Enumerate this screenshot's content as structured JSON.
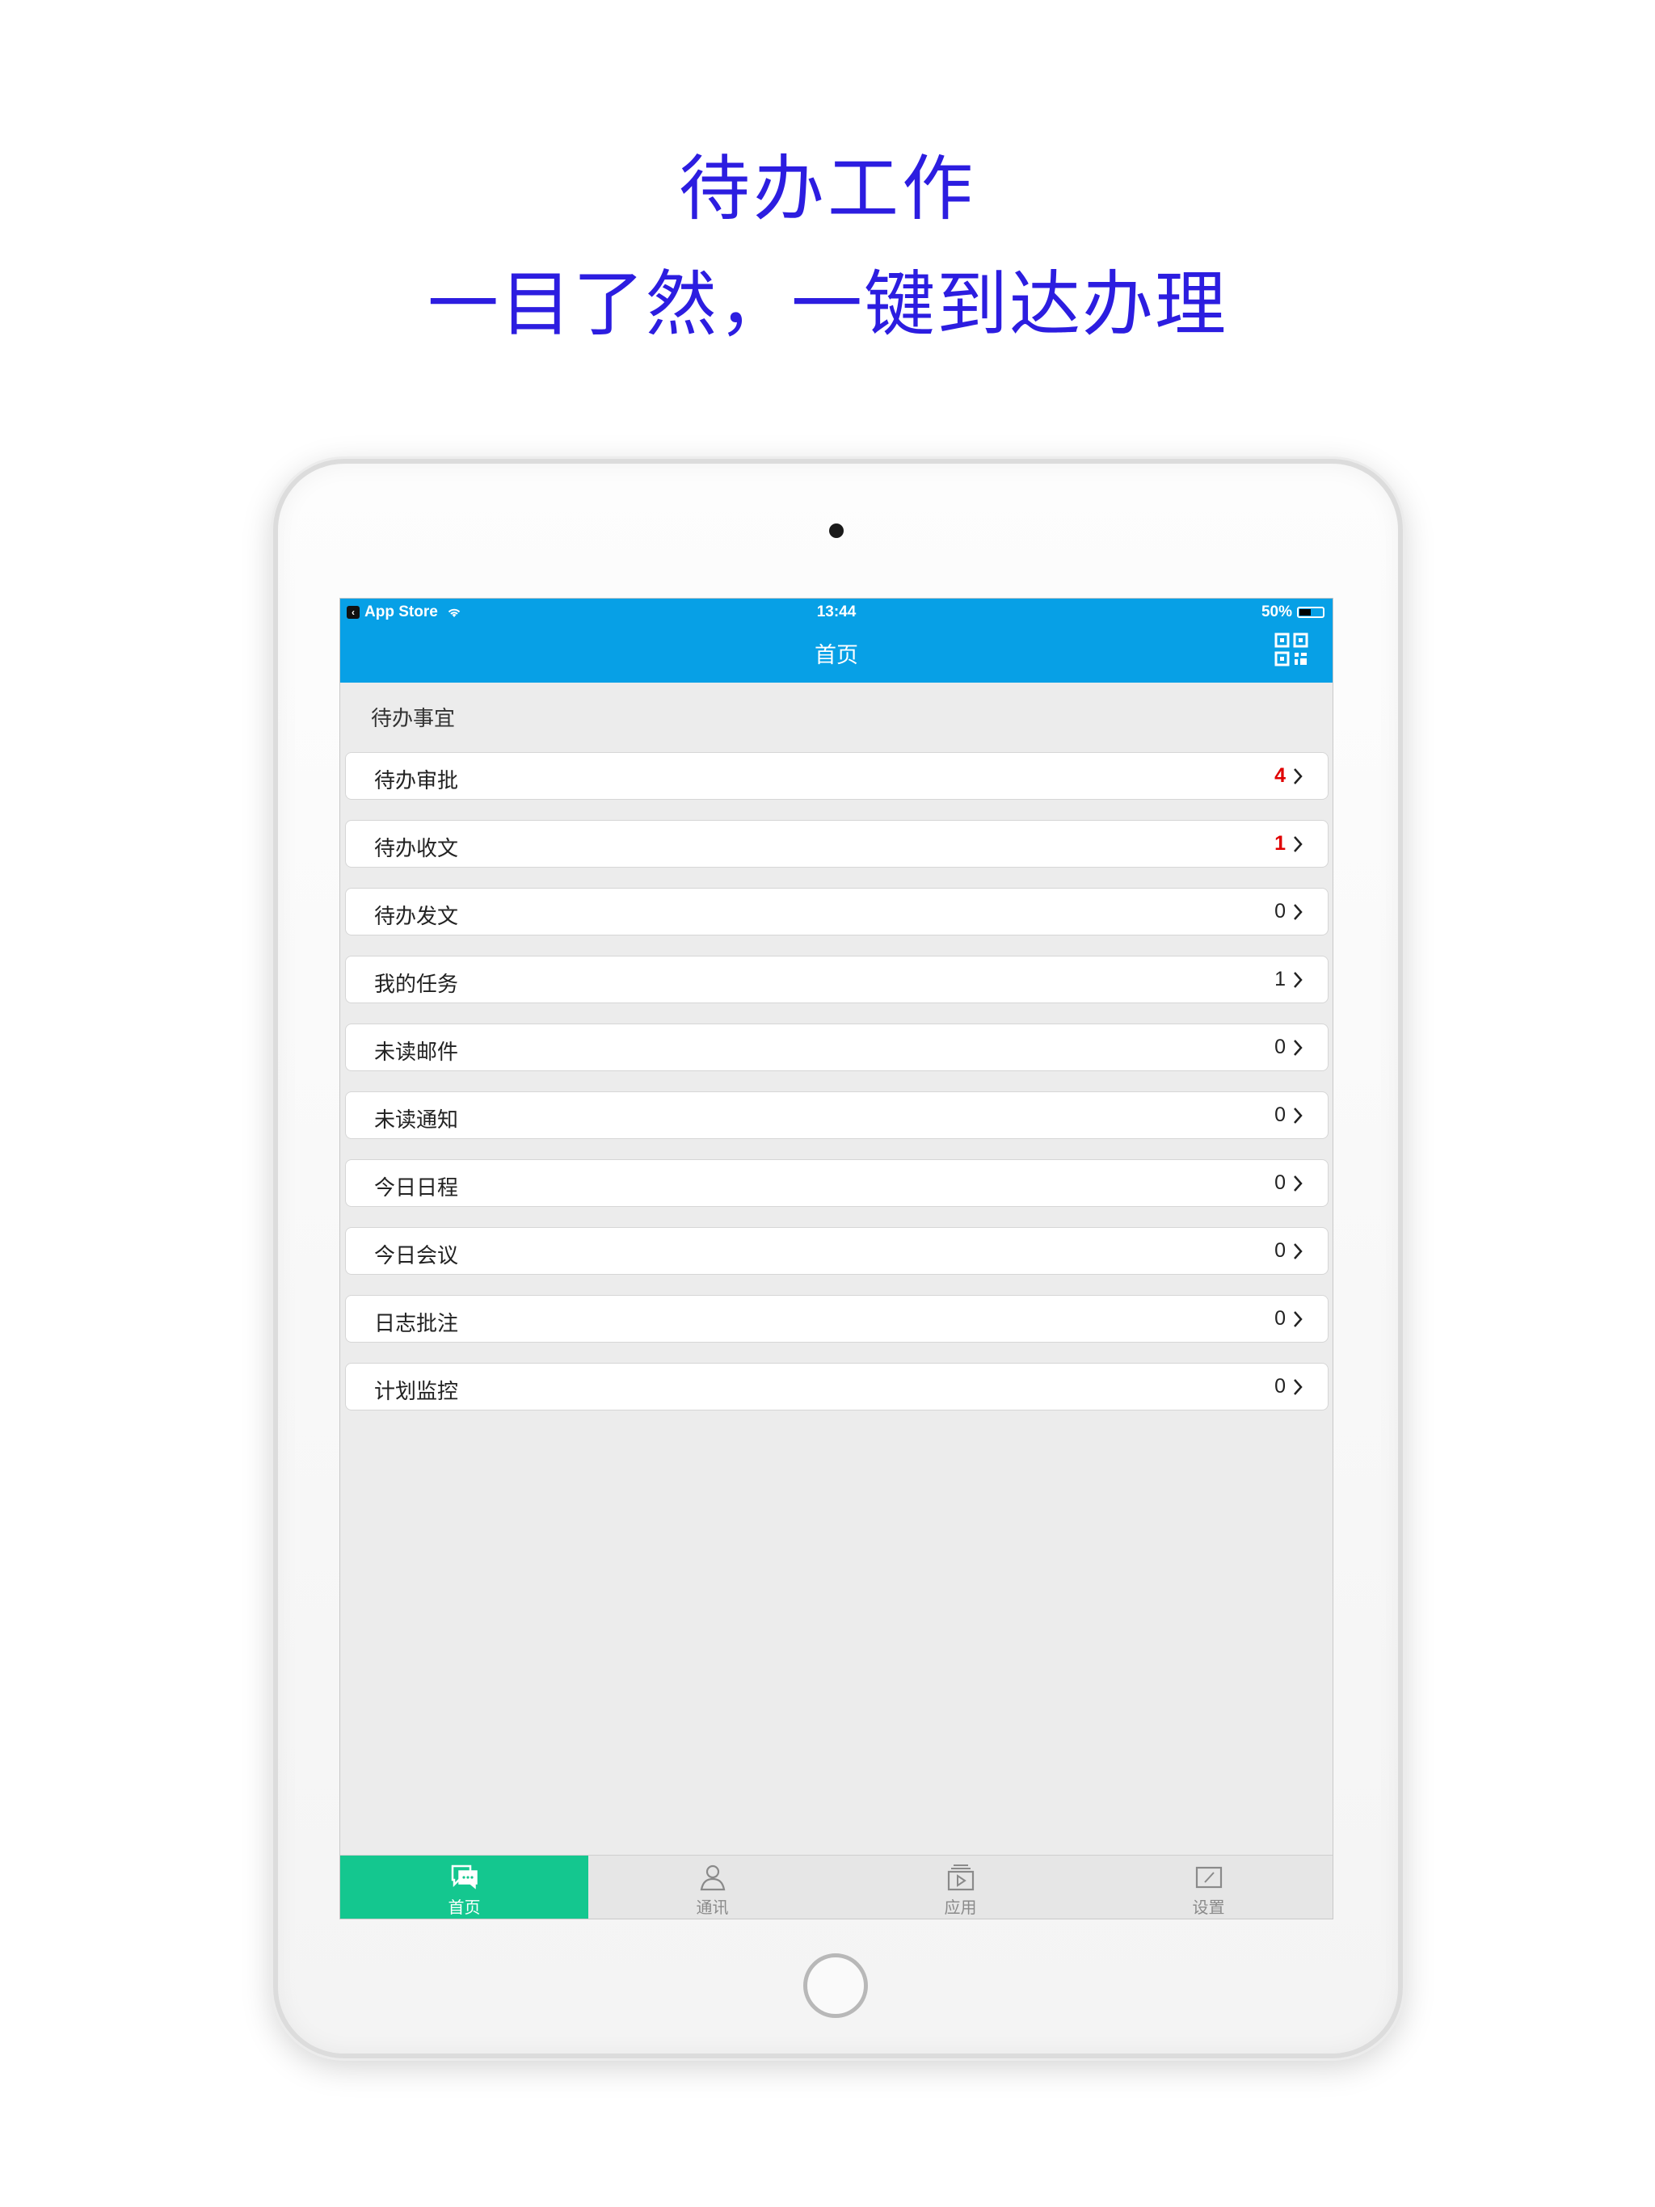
{
  "promo": {
    "line1": "待办工作",
    "line2": "一目了然，一键到达办理"
  },
  "status_bar": {
    "back_app_label": "App Store",
    "time": "13:44",
    "battery": "50%"
  },
  "nav": {
    "title": "首页",
    "right_icon": "qr-code-icon"
  },
  "section": {
    "title": "待办事宜"
  },
  "items": [
    {
      "label": "待办审批",
      "count": "4",
      "highlight": true
    },
    {
      "label": "待办收文",
      "count": "1",
      "highlight": true
    },
    {
      "label": "待办发文",
      "count": "0",
      "highlight": false
    },
    {
      "label": "我的任务",
      "count": "1",
      "highlight": false
    },
    {
      "label": "未读邮件",
      "count": "0",
      "highlight": false
    },
    {
      "label": "未读通知",
      "count": "0",
      "highlight": false
    },
    {
      "label": "今日日程",
      "count": "0",
      "highlight": false
    },
    {
      "label": "今日会议",
      "count": "0",
      "highlight": false
    },
    {
      "label": "日志批注",
      "count": "0",
      "highlight": false
    },
    {
      "label": "计划监控",
      "count": "0",
      "highlight": false
    }
  ],
  "tabs": [
    {
      "label": "首页",
      "icon": "chat-bubble-icon",
      "active": true
    },
    {
      "label": "通讯",
      "icon": "person-icon",
      "active": false
    },
    {
      "label": "应用",
      "icon": "play-box-icon",
      "active": false
    },
    {
      "label": "设置",
      "icon": "edit-box-icon",
      "active": false
    }
  ],
  "colors": {
    "promo_text": "#2c1de0",
    "nav_background": "#07a0e6",
    "active_tab": "#14c78f",
    "badge_red": "#e00000",
    "screen_background": "#ececec"
  }
}
